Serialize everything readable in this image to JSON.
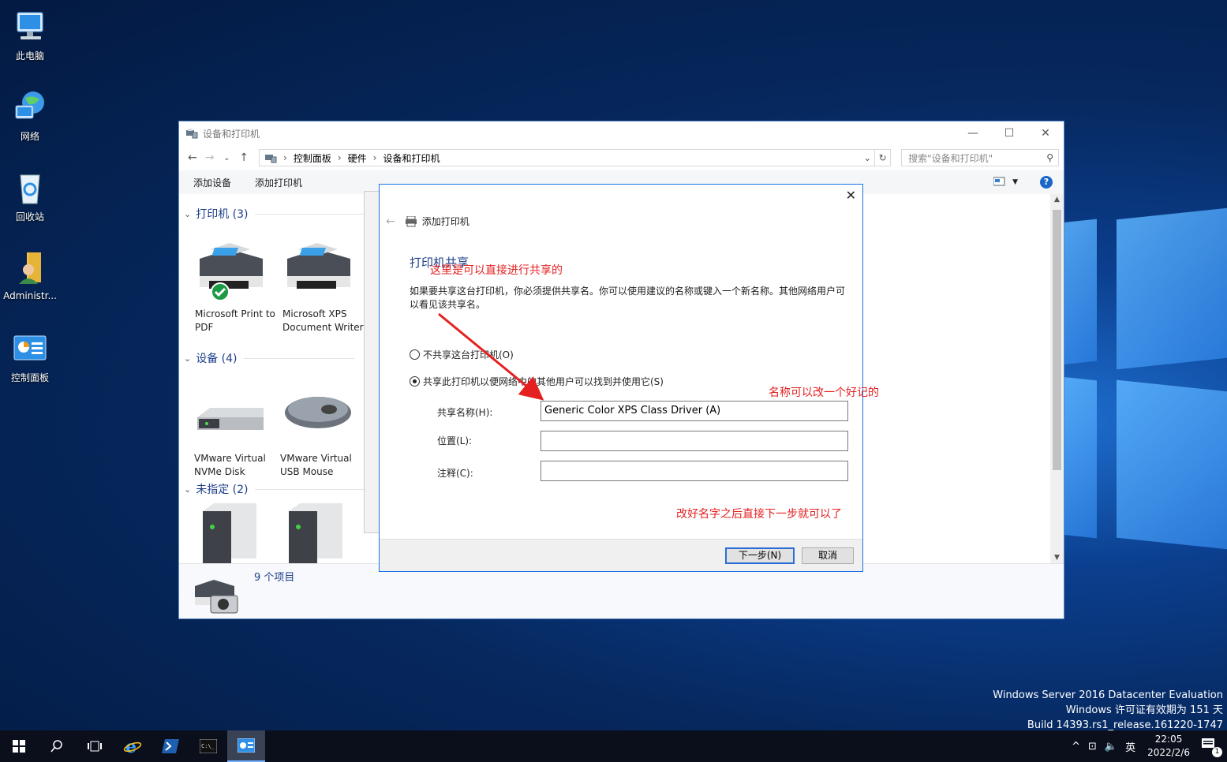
{
  "desktop": {
    "icons": [
      {
        "label": "此电脑"
      },
      {
        "label": "网络"
      },
      {
        "label": "回收站"
      },
      {
        "label": "Administr..."
      },
      {
        "label": "控制面板"
      }
    ],
    "watermark": {
      "line1": "Windows Server 2016 Datacenter Evaluation",
      "line2": "Windows 许可证有效期为 151 天",
      "line3": "Build 14393.rs1_release.161220-1747"
    }
  },
  "window": {
    "title": "设备和打印机",
    "breadcrumb": [
      "控制面板",
      "硬件",
      "设备和打印机"
    ],
    "search_placeholder": "搜索\"设备和打印机\"",
    "toolbar": {
      "add_device": "添加设备",
      "add_printer": "添加打印机"
    },
    "groups": {
      "printers": {
        "title": "打印机 (3)",
        "items": [
          {
            "name": "Microsoft Print to PDF"
          },
          {
            "name": "Microsoft XPS Document Writer"
          }
        ]
      },
      "devices": {
        "title": "设备 (4)",
        "items": [
          {
            "name": "VMware Virtual NVMe Disk"
          },
          {
            "name": "VMware Virtual USB Mouse"
          }
        ]
      },
      "unspecified": {
        "title": "未指定 (2)"
      }
    },
    "status": "9 个项目"
  },
  "dialog": {
    "header": "添加打印机",
    "title": "打印机共享",
    "description": "如果要共享这台打印机，你必须提供共享名。你可以使用建议的名称或键入一个新名称。其他网络用户可以看见该共享名。",
    "option_no_share": "不共享这台打印机(O)",
    "option_share": "共享此打印机以便网络中的其他用户可以找到并使用它(S)",
    "share_name_label": "共享名称(H):",
    "share_name_value": "Generic Color XPS Class Driver (A)",
    "location_label": "位置(L):",
    "location_value": "",
    "comment_label": "注释(C):",
    "comment_value": "",
    "next_button": "下一步(N)",
    "cancel_button": "取消"
  },
  "annotations": {
    "a1": "这里是可以直接进行共享的",
    "a2": "名称可以改一个好记的",
    "a3": "改好名字之后直接下一步就可以了",
    "color": "#e52020"
  },
  "taskbar": {
    "ime": "英",
    "time": "22:05",
    "date": "2022/2/6",
    "notification_count": "1"
  }
}
